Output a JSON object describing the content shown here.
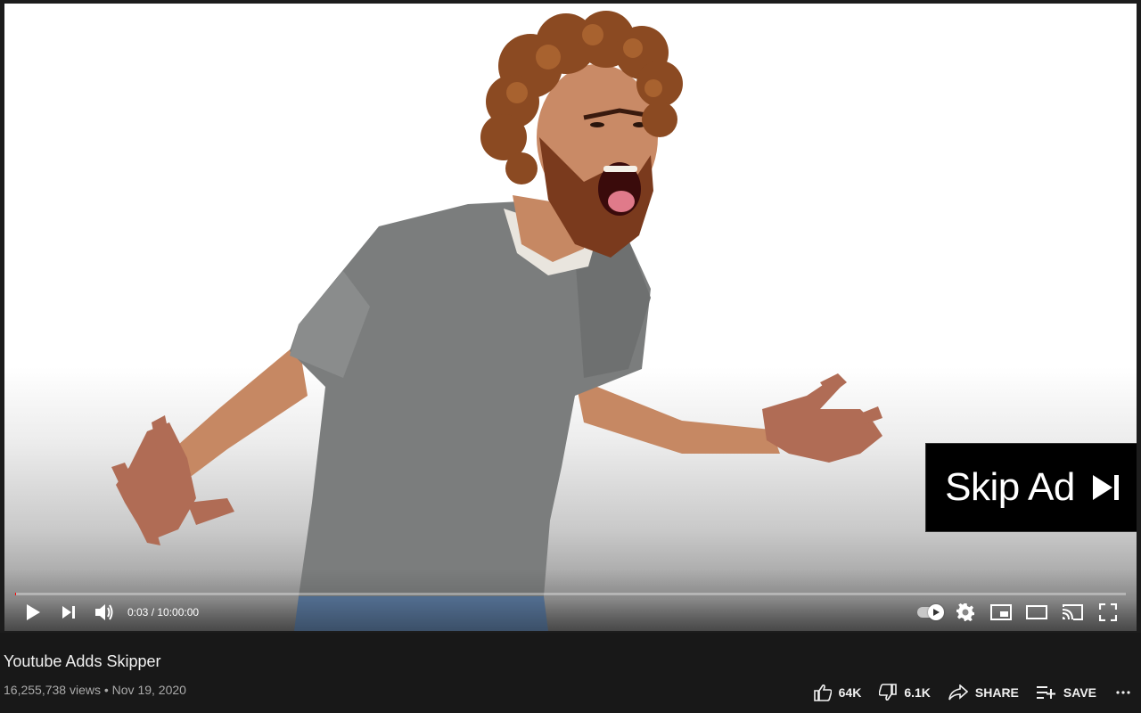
{
  "player": {
    "current_time": "0:03",
    "duration": "10:00:00",
    "time_separator": " / ",
    "progress": 0.0001,
    "skip_ad_label": "Skip Ad",
    "autoplay_on": true
  },
  "video": {
    "title": "Youtube Adds Skipper",
    "views": "16,255,738 views",
    "separator": " • ",
    "date": "Nov 19, 2020"
  },
  "actions": {
    "like_count": "64K",
    "dislike_count": "6.1K",
    "share_label": "SHARE",
    "save_label": "SAVE"
  },
  "icons": {
    "play": "play-icon",
    "next": "next-icon",
    "volume": "volume-icon",
    "autoplay": "autoplay-toggle-icon",
    "settings": "gear-icon",
    "miniplayer": "miniplayer-icon",
    "theater": "theater-mode-icon",
    "cast": "cast-icon",
    "fullscreen": "fullscreen-icon",
    "skip": "skip-next-icon",
    "like": "thumbs-up-icon",
    "dislike": "thumbs-down-icon",
    "share": "share-arrow-icon",
    "save": "playlist-add-icon",
    "more": "more-dots-icon"
  },
  "colors": {
    "page_background": "#181818",
    "progress_played": "#ff0000",
    "skip_ad_background": "#000000",
    "meta_text": "#aaaaaa"
  }
}
